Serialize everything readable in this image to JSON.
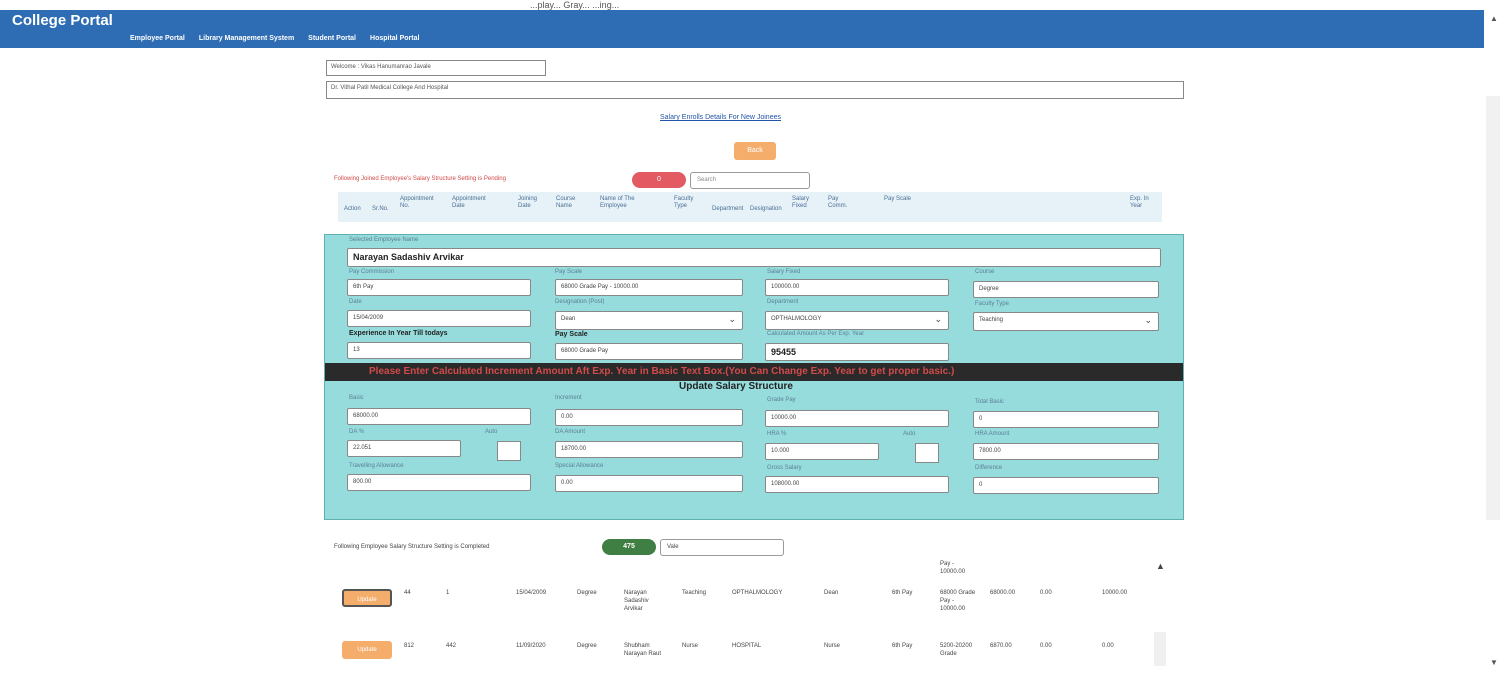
{
  "app": {
    "title": "College Portal",
    "nav": [
      "Employee Portal",
      "Library Management System",
      "Student Portal",
      "Hospital Portal"
    ],
    "hint": "...play... Gray... ...ing...",
    "up_icon": "▲",
    "down_icon": "▼"
  },
  "header": {
    "welcome": "Welcome : Vikas Hanumanrao Javale",
    "college": "Dr. Vithal Patil Medical College And Hospital",
    "link": "Salary Enrolls Details For New Joinees",
    "back_label": "Back"
  },
  "pending": {
    "text": "Following Joined Employee's Salary Structure Setting is Pending",
    "count": "0",
    "search_placeholder": "Search",
    "columns": [
      "Action",
      "Sr.No.",
      "Appointment No.",
      "Appointment Date",
      "Joining Date",
      "Course Name",
      "Name of The Employee",
      "Faculty Type",
      "Department",
      "Designation",
      "Salary Fixed",
      "Pay Comm.",
      "Pay Scale",
      "Exp. In Year"
    ]
  },
  "form": {
    "employee_label": "Selected Employee Name",
    "employee_name": "Narayan Sadashiv Arvikar",
    "pay_commission_label": "Pay Commission",
    "pay_commission": "6th Pay",
    "pay_scale_label": "Pay Scale",
    "pay_scale": "68000 Grade Pay - 10000.00",
    "salary_fixed_label": "Salary Fixed",
    "salary_fixed": "100000.00",
    "course_label": "Course",
    "course": "Degree",
    "date_label": "Date",
    "date": "15/04/2009",
    "designation_label": "Designation (Post)",
    "designation": "Dean",
    "department_label": "Department",
    "department": "OPTHALMOLOGY",
    "faculty_type_label": "Faculty Type",
    "faculty_type": "Teaching",
    "experience_label": "Experience In Year Till todays",
    "experience": "13",
    "pay_scale2_label": "Pay Scale",
    "pay_scale2": "68000 Grade Pay",
    "increment_label": "Calculated Amount As Per Exp. Year",
    "increment": "95455",
    "banner": "Please Enter Calculated Increment Amount Aft Exp. Year in Basic Text Box.(You Can Change Exp. Year to get proper basic.)",
    "section_title": "Update Salary Structure",
    "basic_label": "Basic",
    "basic": "68000.00",
    "increment2_label": "Increment",
    "increment2": "0.00",
    "grade_pay_label": "Grade Pay",
    "grade_pay": "10000.00",
    "total_basic_label": "Total Basic",
    "total_basic": "0",
    "da_label": "DA %",
    "da": "22.051",
    "auto_label": "Auto",
    "da_amount_label": "DA Amount",
    "da_amount": "18700.00",
    "hra_label": "HRA %",
    "hra": "10.000",
    "auto2_label": "Auto",
    "hra_amount_label": "HRA Amount",
    "hra_amount": "7800.00",
    "ta_label": "Travelling Allowance",
    "ta": "800.00",
    "special_label": "Special Allowance",
    "special": "0.00",
    "gross_label": "Gross Salary",
    "gross": "108000.00",
    "difference_label": "Difference",
    "difference": "0"
  },
  "completed": {
    "text": "Following Employee Salary Structure Setting is Completed",
    "count": "475",
    "search_value": "Vale",
    "update_label": "Update",
    "row0_payscale_top": "Pay - 10000.00",
    "rows": [
      {
        "sr": "44",
        "appt": "1",
        "join_date": "15/04/2009",
        "course": "Degree",
        "name": "Narayan Sadashiv Arvikar",
        "faculty": "Teaching",
        "dept": "OPTHALMOLOGY",
        "designation": "Dean",
        "paycomm": "6th Pay",
        "payscale": "68000 Grade Pay - 10000.00",
        "basic": "68000.00",
        "incr": "0.00",
        "grade": "10000.00"
      },
      {
        "sr": "812",
        "appt": "442",
        "join_date": "11/09/2020",
        "course": "Degree",
        "name": "Shubham Narayan Raut",
        "faculty": "Nurse",
        "dept": "HOSPITAL",
        "designation": "Nurse",
        "paycomm": "6th Pay",
        "payscale": "5200-20200 Grade",
        "basic": "6870.00",
        "incr": "0.00",
        "grade": "0.00"
      }
    ]
  }
}
